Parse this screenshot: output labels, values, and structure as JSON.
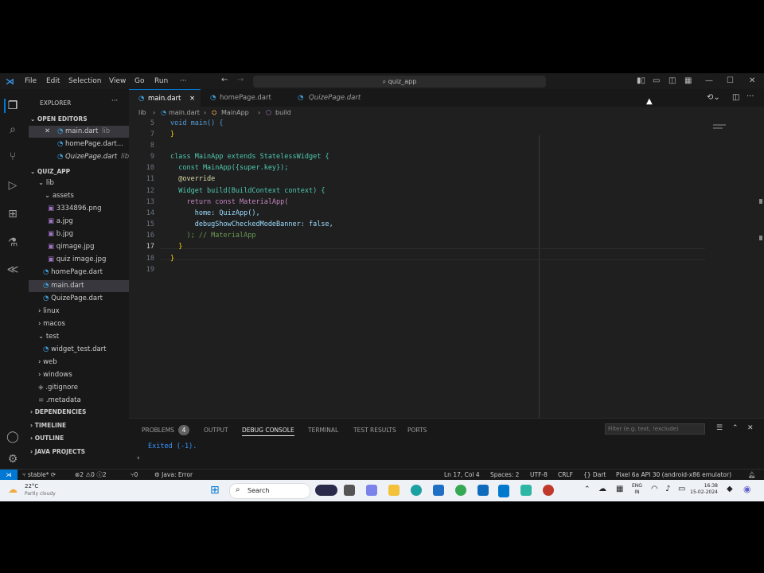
{
  "titlebar": {
    "menu": [
      "File",
      "Edit",
      "Selection",
      "View",
      "Go",
      "Run",
      "···"
    ],
    "search": "quiz_app"
  },
  "sidebar": {
    "title": "EXPLORER",
    "open_editors_label": "OPEN EDITORS",
    "open_editors": [
      {
        "name": "main.dart",
        "suffix": "lib"
      },
      {
        "name": "homePage.dart...",
        "suffix": ""
      },
      {
        "name": "QuizePage.dart",
        "suffix": "lib"
      }
    ],
    "project_label": "QUIZ_APP",
    "tree": [
      "lib",
      "assets",
      "3334896.png",
      "a.jpg",
      "b.jpg",
      "qimage.jpg",
      "quiz image.jpg",
      "homePage.dart",
      "main.dart",
      "QuizePage.dart",
      "linux",
      "macos",
      "test",
      "widget_test.dart",
      "web",
      "windows",
      ".gitignore",
      ".metadata"
    ],
    "bottom_sections": [
      "DEPENDENCIES",
      "TIMELINE",
      "OUTLINE",
      "JAVA PROJECTS"
    ]
  },
  "tabs": [
    {
      "label": "main.dart",
      "close": "×"
    },
    {
      "label": "homePage.dart"
    },
    {
      "label": "QuizePage.dart"
    }
  ],
  "breadcrumb": [
    "lib",
    "main.dart",
    "MainApp",
    "build"
  ],
  "editor": {
    "line_numbers": [
      "5",
      "7",
      "8",
      "9",
      "10",
      "11",
      "12",
      "13",
      "14",
      "15",
      "16",
      "17",
      "18",
      "19"
    ],
    "lines": [
      "void main() {",
      "}",
      "",
      "class MainApp extends StatelessWidget {",
      "  const MainApp({super.key});",
      "  @override",
      "  Widget build(BuildContext context) {",
      "    return const MaterialApp(",
      "      home: QuizApp(),",
      "      debugShowCheckedModeBanner: false,",
      "    ); // MaterialApp",
      "  }",
      "}",
      ""
    ]
  },
  "panel": {
    "tabs": [
      "PROBLEMS",
      "4",
      "OUTPUT",
      "DEBUG CONSOLE",
      "TERMINAL",
      "TEST RESULTS",
      "PORTS"
    ],
    "filter_placeholder": "Filter (e.g. text, !exclude)",
    "output": "Exited (-1)."
  },
  "status": {
    "branch": "stable*",
    "errors": "⊗2 ⚠0 ⓘ2",
    "ports": "⑂0",
    "java": "Java: Error",
    "position": "Ln 17, Col 4",
    "spaces": "Spaces: 2",
    "encoding": "UTF-8",
    "eol": "CRLF",
    "language": "{} Dart",
    "device": "Pixel 6a API 30 (android-x86 emulator)"
  },
  "taskbar": {
    "weather_temp": "22°C",
    "weather_desc": "Partly cloudy",
    "search": "Search",
    "lang": "ENG",
    "region": "IN",
    "time": "16:38",
    "date": "15-02-2024"
  },
  "colors": {
    "accent": "#0078d4",
    "keyword": "#569cd6",
    "class": "#4ec9b0"
  }
}
